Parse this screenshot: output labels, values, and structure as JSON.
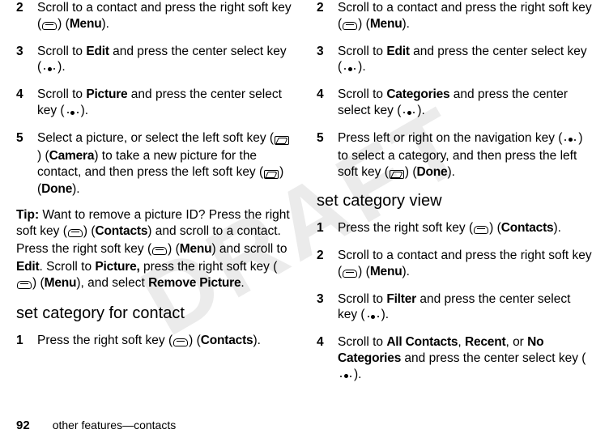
{
  "watermark": "DRAFT",
  "footer": {
    "page": "92",
    "section": "other features—contacts"
  },
  "left": {
    "step2": {
      "num": "2",
      "a": "Scroll to a contact and press the right soft key (",
      "b": ") (",
      "menu": "Menu",
      "c": ")."
    },
    "step3": {
      "num": "3",
      "a": "Scroll to ",
      "edit": "Edit",
      "b": " and press the center select key (",
      "c": ")."
    },
    "step4": {
      "num": "4",
      "a": "Scroll to ",
      "pic": "Picture",
      "b": " and press the center select key (",
      "c": ")."
    },
    "step5": {
      "num": "5",
      "a": "Select a picture, or select the left soft key (",
      "b": ") (",
      "camera": "Camera",
      "c": ") to take a new picture for the contact, and then press the left soft key (",
      "d": ") (",
      "done": "Done",
      "e": ")."
    },
    "tip": {
      "label": "Tip:",
      "a": " Want to remove a picture ID? Press the right soft key (",
      "b": ") (",
      "contacts": "Contacts",
      "c": ") and scroll to a contact. Press the right soft key (",
      "d": ") (",
      "menu": "Menu",
      "e": ") and scroll to ",
      "edit": "Edit",
      "f": ". Scroll to ",
      "picture": "Picture,",
      "g": " press the right soft key (",
      "h": ") (",
      "menu2": "Menu",
      "i": "), and select ",
      "remove": "Remove Picture",
      "j": "."
    },
    "heading": "set category for contact",
    "s1": {
      "num": "1",
      "a": "Press the right soft key (",
      "b": ") (",
      "contacts": "Contacts",
      "c": ")."
    }
  },
  "right": {
    "step2": {
      "num": "2",
      "a": "Scroll to a contact and press the right soft key (",
      "b": ") (",
      "menu": "Menu",
      "c": ")."
    },
    "step3": {
      "num": "3",
      "a": "Scroll to ",
      "edit": "Edit",
      "b": " and press the center select key (",
      "c": ")."
    },
    "step4": {
      "num": "4",
      "a": "Scroll to ",
      "cat": "Categories",
      "b": " and press the center select key (",
      "c": ")."
    },
    "step5": {
      "num": "5",
      "a": "Press left or right on the navigation key (",
      "b": ") to select a category, and then press the left soft key (",
      "c": ") (",
      "done": "Done",
      "d": ")."
    },
    "heading": "set category view",
    "s1": {
      "num": "1",
      "a": "Press the right soft key (",
      "b": ") (",
      "contacts": "Contacts",
      "c": ")."
    },
    "s2": {
      "num": "2",
      "a": "Scroll to a contact and press the right soft key (",
      "b": ") (",
      "menu": "Menu",
      "c": ")."
    },
    "s3": {
      "num": "3",
      "a": "Scroll to ",
      "filter": "Filter",
      "b": " and press the center select key (",
      "c": ")."
    },
    "s4": {
      "num": "4",
      "a": "Scroll to ",
      "all": "All Contacts",
      "comma1": ", ",
      "recent": "Recent",
      "comma2": ", or ",
      "nocat": "No Categories",
      "b": " and press the center select key (",
      "c": ")."
    }
  }
}
